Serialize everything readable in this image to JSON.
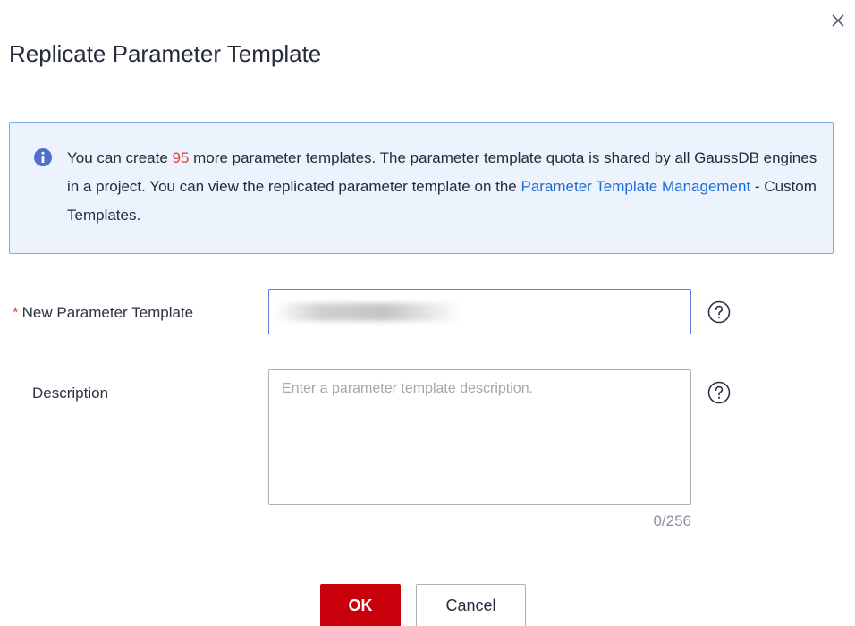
{
  "dialog": {
    "title": "Replicate Parameter Template",
    "close_icon": "close-icon"
  },
  "notice": {
    "icon": "info-icon",
    "text_before_quota": "You can create ",
    "quota": "95",
    "text_after_quota": " more parameter templates. The parameter template quota is shared by all GaussDB engines in a project. You can view the replicated parameter template on the ",
    "link_text": "Parameter Template Management",
    "text_after_link": " - Custom Templates."
  },
  "form": {
    "template_name": {
      "required_mark": "*",
      "label": "New Parameter Template",
      "value": "",
      "help_icon": "question-circle-icon"
    },
    "description": {
      "label": "Description",
      "placeholder": "Enter a parameter template description.",
      "value": "",
      "counter": "0/256",
      "help_icon": "question-circle-icon"
    }
  },
  "actions": {
    "ok_label": "OK",
    "cancel_label": "Cancel"
  },
  "colors": {
    "primary_button": "#c7000b",
    "notice_background": "#edf3fc",
    "notice_border": "#7fa7ea",
    "link": "#1c6cd6",
    "quota": "#e3403b",
    "info_icon": "#526ecc",
    "input_focus_border": "#5e7ce0"
  }
}
